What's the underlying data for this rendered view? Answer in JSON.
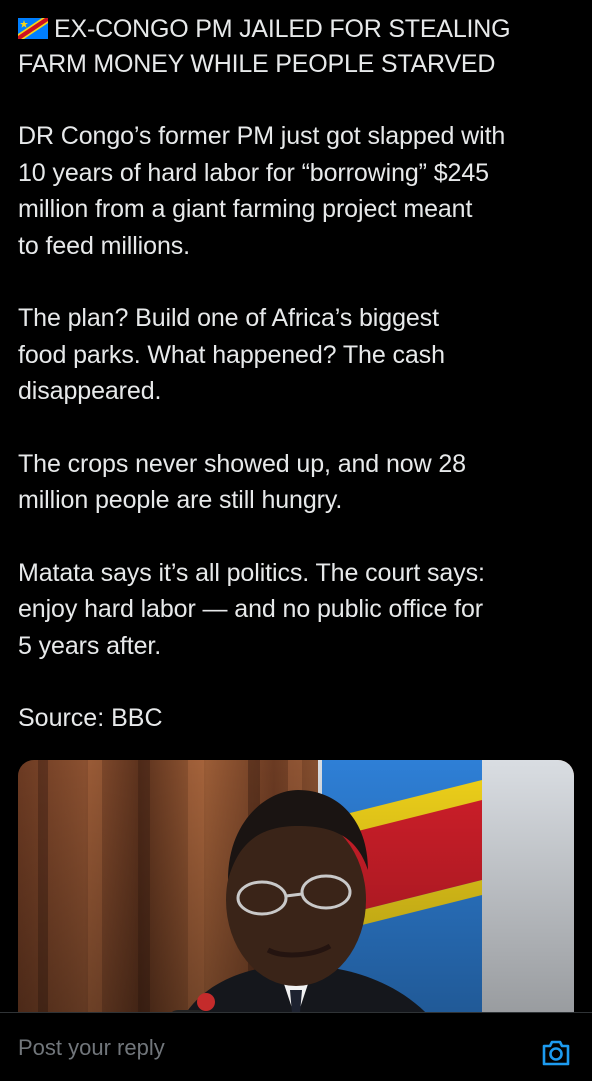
{
  "post": {
    "flag_icon": "dr-congo-flag-icon",
    "headline_line1": "EX-CONGO PM JAILED FOR STEALING",
    "headline_line2": "FARM MONEY WHILE PEOPLE STARVED",
    "paragraphs": [
      {
        "lines": [
          "DR Congo’s former PM just got slapped with",
          "10 years of hard labor for “borrowing” $245",
          "million from a giant farming project meant",
          "to feed millions."
        ]
      },
      {
        "lines": [
          "The plan? Build one of Africa’s biggest",
          "food parks. What happened? The cash",
          "disappeared."
        ]
      },
      {
        "lines": [
          "The crops never showed up, and now 28",
          "million people are still hungry."
        ]
      },
      {
        "lines": [
          "Matata says it’s all politics. The court says:",
          "enjoy hard labor — and no public office for",
          "5 years after."
        ]
      }
    ],
    "source": "Source: BBC",
    "image": "photo of man in glasses at microphone in front of DR Congo flag"
  },
  "reply_bar": {
    "placeholder": "Post your reply",
    "camera_icon": "camera-icon"
  },
  "colors": {
    "background": "#000000",
    "text": "#e7e9ea",
    "muted": "#71767b",
    "accent": "#1d9bf0",
    "divider": "#2f3336"
  }
}
